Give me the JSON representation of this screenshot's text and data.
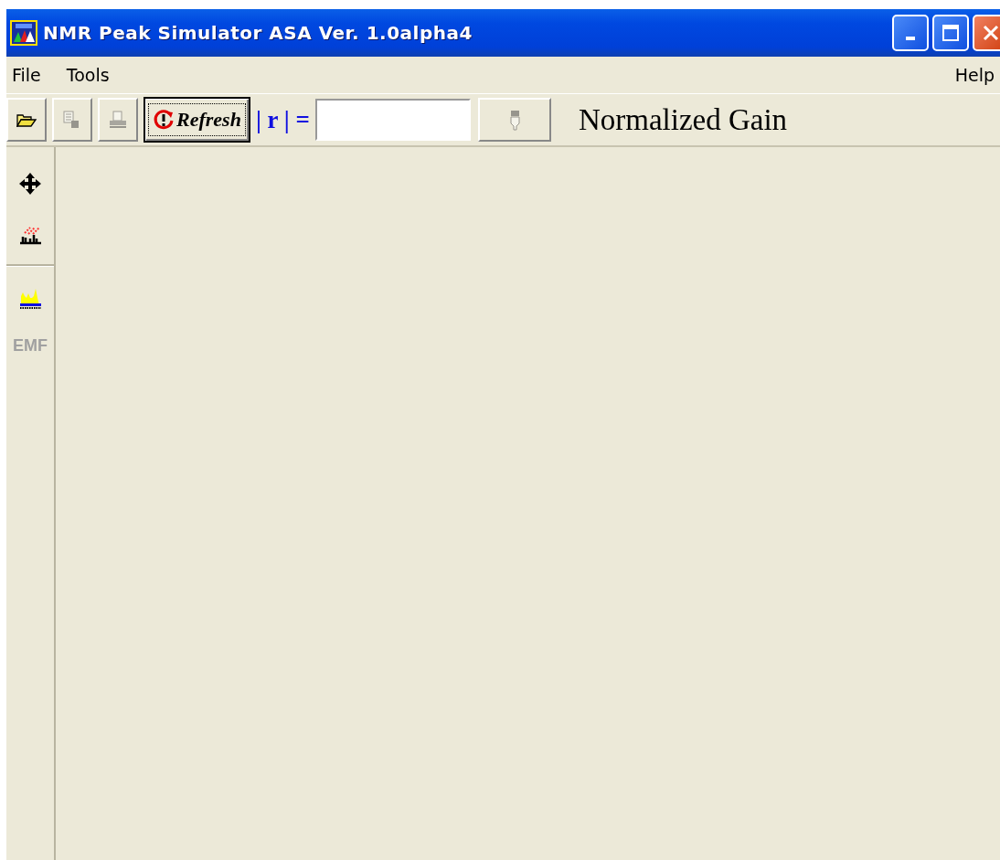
{
  "window": {
    "title": "NMR Peak Simulator ASA Ver. 1.0alpha4"
  },
  "menu": {
    "left": [
      {
        "label": "File"
      },
      {
        "label": "Tools"
      }
    ],
    "right": [
      {
        "label": "Help"
      }
    ]
  },
  "toolbar": [
    {
      "kind": "open",
      "disabled": false
    },
    {
      "kind": "copy",
      "disabled": true
    },
    {
      "kind": "print",
      "disabled": true
    },
    {
      "kind": "refresh",
      "label": "Refresh"
    },
    {
      "kind": "formula",
      "label": "| r | ="
    },
    {
      "kind": "field"
    },
    {
      "kind": "pointer",
      "disabled": true
    },
    {
      "kind": "caption",
      "label": "Normalized Gain"
    }
  ],
  "side_tools": [
    {
      "kind": "move"
    },
    {
      "kind": "peaks"
    },
    {
      "kind": "separator"
    },
    {
      "kind": "fill"
    },
    {
      "kind": "text",
      "label": "EMF",
      "disabled": true
    }
  ]
}
